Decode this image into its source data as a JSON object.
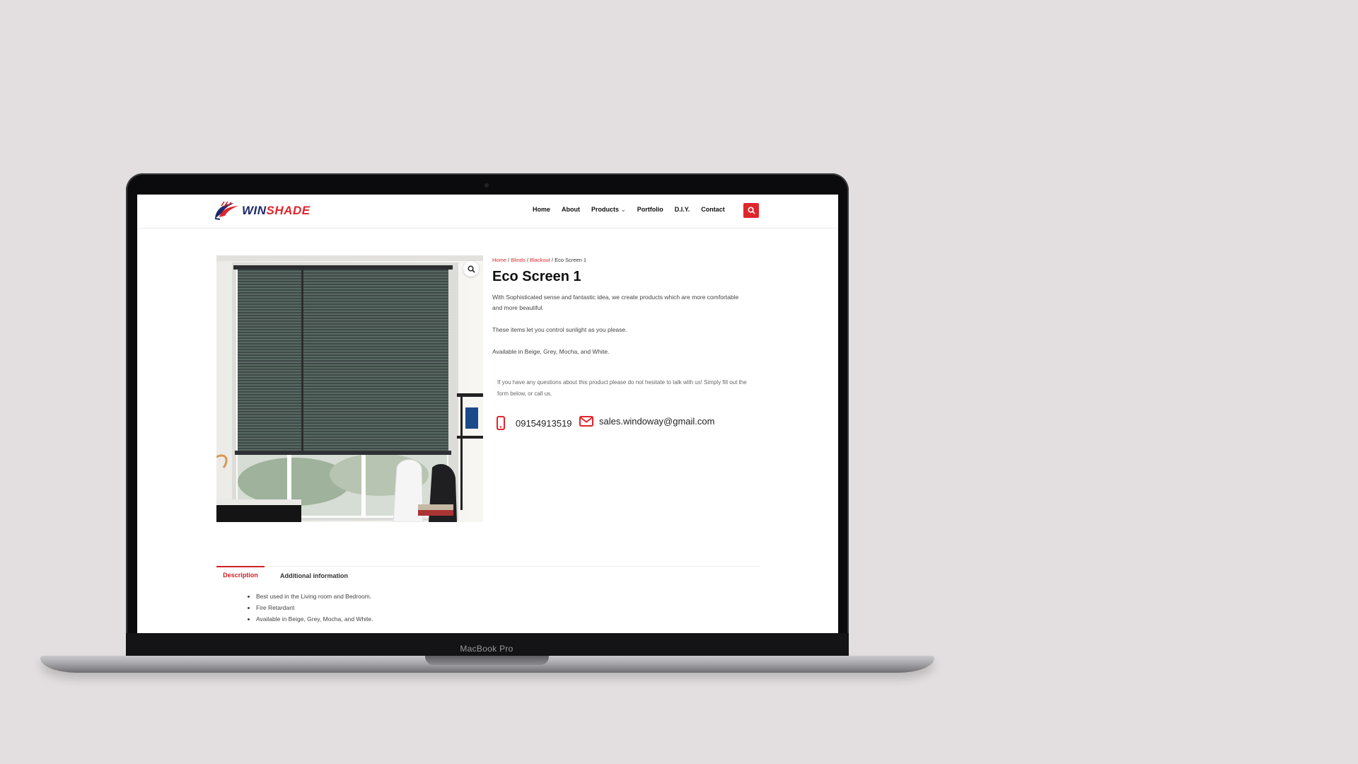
{
  "device": {
    "model_label": "MacBook Pro"
  },
  "site": {
    "logo": {
      "part1": "WIN",
      "part2": "SHADE",
      "icon": "fan-logo-icon"
    },
    "nav": [
      {
        "label": "Home"
      },
      {
        "label": "About"
      },
      {
        "label": "Products",
        "has_dropdown": true
      },
      {
        "label": "Portfolio"
      },
      {
        "label": "D.I.Y."
      },
      {
        "label": "Contact"
      }
    ],
    "search_icon": "search-icon",
    "colors": {
      "accent": "#e0262b",
      "logo_blue": "#1d2a6b",
      "text": "#111111"
    }
  },
  "product": {
    "breadcrumb": [
      {
        "label": "Home",
        "link": true
      },
      {
        "label": "Blinds",
        "link": true
      },
      {
        "label": "Blackout",
        "link": true
      },
      {
        "label": "Eco Screen 1",
        "link": false
      }
    ],
    "breadcrumb_sep": "/",
    "title": "Eco Screen 1",
    "description_lines": [
      "With Sophisticated sense and fantastic idea, we create products which are more comfortable and more beautiful.",
      "These items let you control sunlight as you please.",
      "Available in Beige, Grey, Mocha, and White."
    ],
    "question_text": "If you have any questions about this product please do not hesitate to talk with us! Simply fill out the form below, or call us.",
    "phone": "09154913519",
    "email": "sales.windoway@gmail.com",
    "image_zoom_icon": "magnifier-icon"
  },
  "tabs": [
    {
      "label": "Description",
      "active": true
    },
    {
      "label": "Additional information",
      "active": false
    }
  ],
  "description_bullets": [
    "Best used in the Living room and Bedroom.",
    "Fire Retardant",
    "Available in Beige, Grey, Mocha, and White."
  ]
}
